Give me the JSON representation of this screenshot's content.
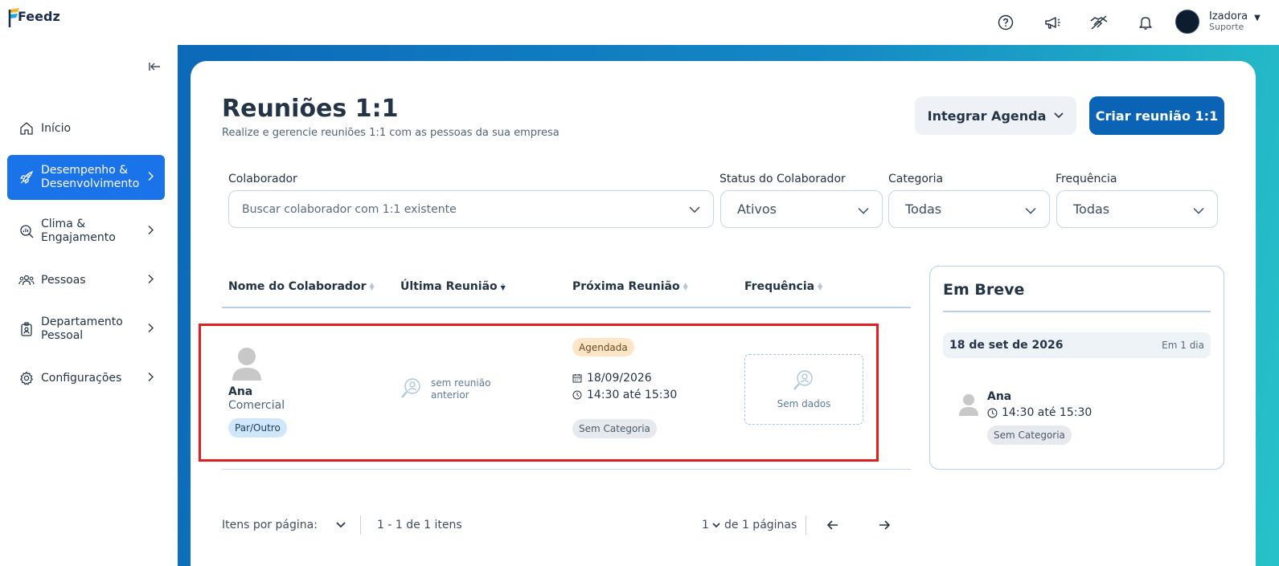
{
  "brand": {
    "name": "Feedz"
  },
  "user": {
    "name": "Izadora",
    "role": "Suporte"
  },
  "top_icons": [
    "help-icon",
    "megaphone-icon",
    "handshake-icon",
    "bell-icon"
  ],
  "sidebar": {
    "items": [
      {
        "label": "Início",
        "icon": "home-icon"
      },
      {
        "label": "Desempenho & Desenvolvimento",
        "icon": "rocket-icon",
        "active": true
      },
      {
        "label": "Clima & Engajamento",
        "icon": "search-chart-icon"
      },
      {
        "label": "Pessoas",
        "icon": "people-icon"
      },
      {
        "label": "Departamento Pessoal",
        "icon": "badge-icon"
      },
      {
        "label": "Configurações",
        "icon": "gear-icon"
      }
    ],
    "item0": "Início",
    "item1a": "Desempenho &",
    "item1b": "Desenvolvimento",
    "item2a": "Clima &",
    "item2b": "Engajamento",
    "item3": "Pessoas",
    "item4a": "Departamento",
    "item4b": "Pessoal",
    "item5": "Configurações"
  },
  "page": {
    "title": "Reuniões 1:1",
    "subtitle": "Realize e gerencie reuniões 1:1 com as pessoas da sua empresa",
    "integrar_label": "Integrar Agenda",
    "criar_label": "Criar reunião 1:1"
  },
  "filters": {
    "colaborador": {
      "label": "Colaborador",
      "placeholder": "Buscar colaborador com 1:1 existente"
    },
    "status": {
      "label": "Status do Colaborador",
      "value": "Ativos"
    },
    "categoria": {
      "label": "Categoria",
      "value": "Todas"
    },
    "frequencia": {
      "label": "Frequência",
      "value": "Todas"
    }
  },
  "table": {
    "columns": [
      "Nome do Colaborador",
      "Última Reunião",
      "Próxima Reunião",
      "Frequência"
    ],
    "col0": "Nome do Colaborador",
    "col1": "Última Reunião",
    "col2": "Próxima Reunião",
    "col3": "Frequência",
    "rows": [
      {
        "name": "Ana",
        "department": "Comercial",
        "relationship": "Par/Outro",
        "last_meeting_a": "sem reunião",
        "last_meeting_b": "anterior",
        "status": "Agendada",
        "date": "18/09/2026",
        "time": "14:30 até 15:30",
        "category": "Sem Categoria",
        "frequency": "Sem dados"
      }
    ]
  },
  "em_breve": {
    "title": "Em Breve",
    "date": "18 de set de 2026",
    "relative": "Em 1 dia",
    "name": "Ana",
    "time": "14:30 até 15:30",
    "category": "Sem Categoria"
  },
  "pagination": {
    "per_page_label": "Itens por página:",
    "range": "1 - 1 de 1 itens",
    "page": "1",
    "of_pages": "de 1 páginas"
  },
  "colors": {
    "primary": "#0b63b6",
    "active_nav": "#1a73e8",
    "highlight": "#e02020"
  }
}
